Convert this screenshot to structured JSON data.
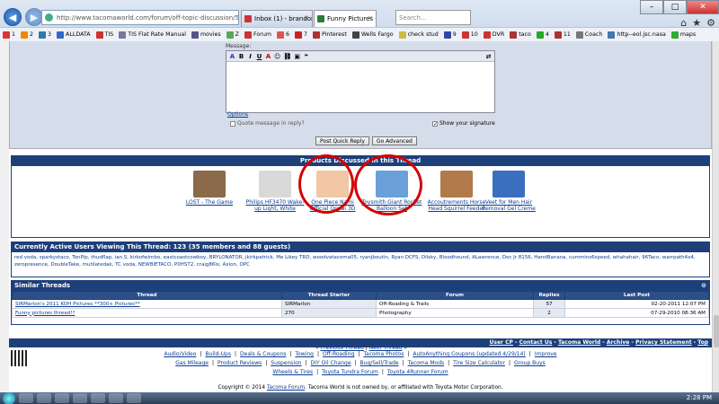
{
  "browser": {
    "url": "http://www.tacomaworld.com/forum/off-topic-discussion/53",
    "tabs": [
      {
        "label": "Inbox (1) - brandonr21"
      },
      {
        "label": "Funny Pictures - Pag..."
      }
    ],
    "search_text": "Search..."
  },
  "favorites": [
    "1",
    "2",
    "3",
    "ALLDATA",
    "TIS",
    "TIS Flat Rate Manual",
    "movies",
    "Z",
    "Forum",
    "6",
    "7",
    "Pinterest",
    "Wells Fargo",
    "check stud",
    "9",
    "10",
    "DVR",
    "taco",
    "4",
    "11",
    "Coach",
    "http--eol.jsc.nasa",
    "maps"
  ],
  "reply": {
    "message_label": "Message:",
    "options_link": "Options",
    "quote_label": "Quote message in reply?",
    "signature_label": "Show your signature",
    "post_button": "Post Quick Reply",
    "advanced_button": "Go Advanced"
  },
  "products": {
    "title": "Products Discussed in this Thread",
    "items": [
      {
        "name": "LOST - The Game",
        "color": "#8a6a4a"
      },
      {
        "name": "Philips HF3470 Wake-up Light, White",
        "color": "#d9d9d9"
      },
      {
        "name": "One Piece Nami Official Oppai 3D",
        "color": "#f2c7a5"
      },
      {
        "name": "Toysmith Giant Rocket Balloon Set",
        "color": "#6aa0d8"
      },
      {
        "name": "Accoutrements Horse Head Squirrel Feeder",
        "color": "#b07a4a"
      },
      {
        "name": "Veet for Men Hair Removal Gel Creme",
        "color": "#3a6fc0"
      }
    ],
    "prev": "Previous Thread",
    "next": "Next Thread"
  },
  "active_users": {
    "title": "Currently Active Users Viewing This Thread: 123 (35 members and 88 guests)",
    "list": "red voda, sparkystaco, TonPip, thudflap, ian.S, kirkofwimbo, eastcoastcowboy, BRYLONATOR, jkirkpatrick, Me Likey TRD, woodvatacoma05, ryanjboutin, Ryan DCFS, Dilsky, Bloodhound, ALawrence, Doc Jr 8156, HandBanana, cummins6speed, whahahair, 96Taco, warrpath4x4, zeropresence, DoubleTake, mutilatedak, TC voda, NEWBIETACO, P0HST2, craig86lx, Axion, OPC"
  },
  "similar": {
    "title": "Similar Threads",
    "columns": [
      "Thread",
      "Thread Starter",
      "Forum",
      "Replies",
      "Last Post"
    ],
    "rows": [
      {
        "thread": "SIRMarlon's 2011 KOH Pictures **300+ Pictures**",
        "starter": "SIRMarlon",
        "forum": "Off-Roading & Trails",
        "replies": "57",
        "last": "02-20-2011 12:07 PM"
      },
      {
        "thread": "Funny pictures thread!?",
        "starter": "270",
        "forum": "Photography",
        "replies": "2",
        "last": "07-29-2010 08:36 AM"
      }
    ]
  },
  "footer": {
    "bar_links": [
      "User CP",
      "Contact Us",
      "Tacoma World",
      "Archive",
      "Privacy Statement",
      "Top"
    ],
    "link_rows": [
      [
        "Audio/Video",
        "Build-Ups",
        "Deals & Coupons",
        "Towing",
        "Off-Roading",
        "Tacoma Photos",
        "AutoAnything Coupons (updated 4/29/14)",
        "Improve"
      ],
      [
        "Gas Mileage",
        "Product Reviews",
        "Suspension",
        "DIY Oil Change",
        "Bug/Sell/Trade",
        "Tacoma Mods",
        "Tire Size Calculator",
        "Group Buys"
      ],
      [
        "Wheels & Tires",
        "Toyota Tundra Forum",
        "Toyota 4Runner Forum"
      ]
    ],
    "copyright_pre": "Copyright © 2014",
    "copyright_link": "Tacoma Forum",
    "copyright_post": ". Tacoma World is not owned by, or affiliated with Toyota Motor Corporation."
  },
  "taskbar": {
    "clock": "2:28 PM"
  }
}
